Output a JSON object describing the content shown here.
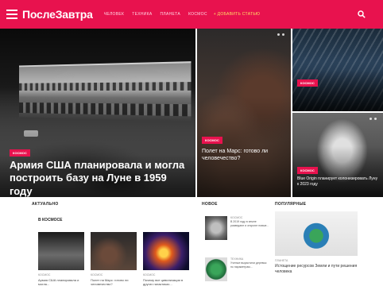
{
  "header": {
    "logo": "ПослеЗавтра",
    "nav": [
      "Человек",
      "Техника",
      "Планета",
      "Космос"
    ],
    "add_article": "+ Добавить статью"
  },
  "hero": {
    "main": {
      "badge": "Космос",
      "title": "Армия США планировала и могла построить базу на Луне в 1959 году"
    },
    "mid": {
      "badge": "Космос",
      "title": "Полет на Марс: готово ли человечество?"
    },
    "top_right": {
      "badge": "Космос",
      "title": ""
    },
    "bottom_right": {
      "badge": "Космос",
      "title": "Blue Origin планирует колонизировать Луну к 2023 году"
    }
  },
  "sections": {
    "actual": "Актуально",
    "in_space": "В космосе",
    "new": "Новое",
    "popular": "Популярные"
  },
  "space_cards": [
    {
      "cat": "Космос",
      "text": "Армия США планировала и могла..."
    },
    {
      "cat": "Космос",
      "text": "Полет на Марс: готово ли человечество?"
    },
    {
      "cat": "Космос",
      "text": "Почему все цивилизации в других галактиках..."
    }
  ],
  "new_items": [
    {
      "cat": "Космос",
      "text": "В 2019 году в земле разведают и откроют новые..."
    },
    {
      "cat": "Техника",
      "text": "Ученые вырастили деревья по параметрам..."
    }
  ],
  "popular_item": {
    "cat": "Планета",
    "text": "Истощение ресурсов Земли и пути решения человека"
  },
  "colors": {
    "brand": "#e8124e",
    "accent": "#ffe066"
  }
}
